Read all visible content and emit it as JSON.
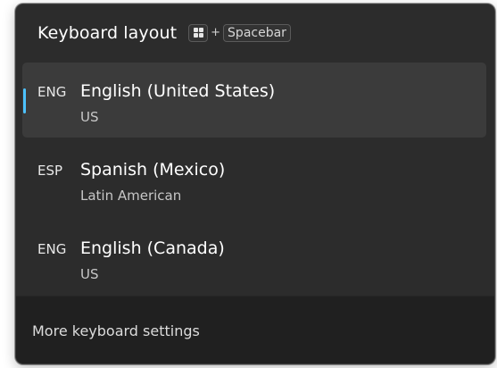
{
  "header": {
    "title": "Keyboard layout",
    "shortcut": {
      "key1_icon": "windows-logo-icon",
      "plus": "+",
      "key2": "Spacebar"
    }
  },
  "layouts": [
    {
      "code": "ENG",
      "name": "English (United States)",
      "keyboard": "US",
      "selected": true
    },
    {
      "code": "ESP",
      "name": "Spanish (Mexico)",
      "keyboard": "Latin American",
      "selected": false
    },
    {
      "code": "ENG",
      "name": "English (Canada)",
      "keyboard": "US",
      "selected": false
    }
  ],
  "footer": {
    "more_settings": "More keyboard settings"
  },
  "colors": {
    "accent": "#4cc2ff",
    "flyout_bg": "#2c2c2c",
    "selected_bg": "#3b3b3b",
    "footer_bg": "#202020"
  }
}
